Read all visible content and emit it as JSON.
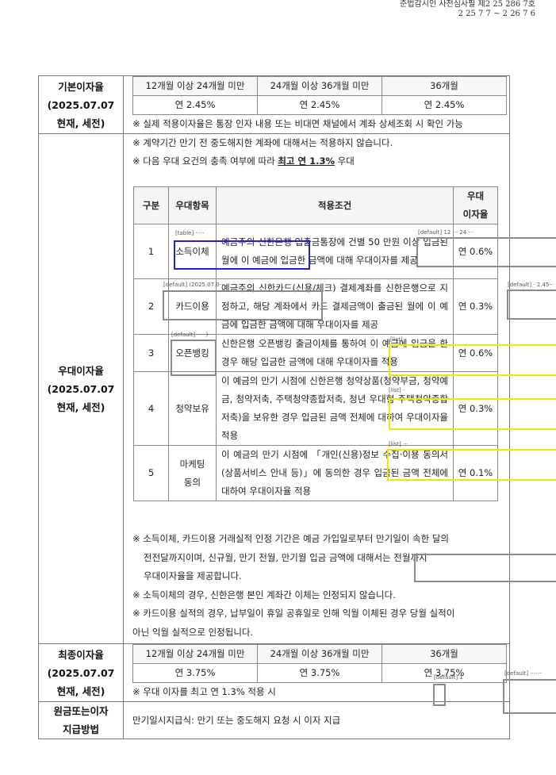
{
  "header": {
    "line1": "준법감시인 사전심사필 제2 25   286   7호",
    "line2": "2 25   7   7 ~ 2 26   7   6"
  },
  "base_rate": {
    "label": [
      "기본이자율",
      "(2025.07.07",
      "현재, 세전)"
    ],
    "headers": [
      "12개월 이상 24개월 미만",
      "24개월 이상 36개월 미만",
      "36개월"
    ],
    "values": [
      "연 2.45%",
      "연 2.45%",
      "연 2.45%"
    ],
    "note": "※ 실제 적용이자율은 통장 인자 내용 또는 비대면 채널에서 계좌 상세조회 시 확인 가능"
  },
  "preferential": {
    "label": [
      "우대이자율",
      "(2025.07.07",
      "현재, 세전)"
    ],
    "note1": "※ 계약기간 만기 전 중도해지한 계좌에 대해서는 적용하지 않습니다.",
    "note2_pre": "※ 다음 우대 요건의 충족 여부에 따라 ",
    "note2_u": "최고 연 1.3%",
    "note2_post": " 우대",
    "table_headers": [
      "구분",
      "우대항목",
      "적용조건",
      "우대",
      "이자율"
    ],
    "rows": [
      {
        "no": "1",
        "item": "소득이체",
        "cond": "예금주의 신한은행 입출금통장에 건별 50 만원 이상 입금된 월에 이 예금에 입금한 금액에 대해 우대이자를 제공",
        "rate": "연 0.6%"
      },
      {
        "no": "2",
        "item": "카드이용",
        "cond": "예금주의 신한카드(신용/체크) 결제계좌를 신한은행으로 지정하고, 해당 계좌에서 카드 결제금액이 출금된 월에 이 예금에 입금한 금액에 대해 우대이자를 제공",
        "rate": "연 0.3%"
      },
      {
        "no": "3",
        "item": "오픈뱅킹",
        "cond": "신한은행 오픈뱅킹 출금이체를 통하여 이 예금에 입금을 한 경우 해당 입금한 금액에 대해 우대이자를 적용",
        "rate": "연 0.6%"
      },
      {
        "no": "4",
        "item": "청약보유",
        "cond": "이 예금의 만기 시점에 신한은행 청약상품(청약부금, 청약예금, 청약저축, 주택청약종합저축, 청년 우대형 주택청약종합저축)을 보유한 경우 입금된 금액 전체에 대하여 우대이자율 적용",
        "rate": "연 0.3%"
      },
      {
        "no": "5",
        "item": "마케팅 동의",
        "cond": "이 예금의 만기 시점에 「개인(신용)정보 수집·이용 동의서(상품서비스 안내 등)」에 동의한 경우 입금된 금액 전체에 대하여 우대이자율 적용",
        "rate": "연 0.1%"
      }
    ],
    "foot1": "※ 소득이체, 카드이용 거래실적 인정 기간은 예금 가입일로부터 만기일이 속한 달의",
    "foot1b": "전전달까지이며, 신규월, 만기 전월, 만기월 입금 금액에 대해서는 전월까지",
    "foot1c": "우대이자율을 제공합니다.",
    "foot2": "※ 소득이체의 경우, 신한은행 본인 계좌간 이체는 인정되지 않습니다.",
    "foot3": "※ 카드이용 실적의 경우, 납부일이 휴일 공휴일로 인해 익월 이체된 경우 당월 실적이",
    "foot3b": "아닌 익월 실적으로 인정됩니다."
  },
  "final_rate": {
    "label": [
      "최종이자율",
      "(2025.07.07",
      "현재, 세전)"
    ],
    "headers": [
      "12개월 이상 24개월 미만",
      "24개월 이상 36개월 미만",
      "36개월"
    ],
    "values": [
      "연 3.75%",
      "연 3.75%",
      "연 3.75%"
    ],
    "note": "※ 우대 이자를 최고 연 1.3% 적용 시"
  },
  "payment": {
    "label": [
      "원금또는이자",
      "지급방법"
    ],
    "text": "만기일시지급식: 만기 또는 중도해지 요청 시 이자 지급"
  },
  "overlays": {
    "tag_table": "[table] ·····",
    "tag_default1": "[default] 12 ··· 24 ···",
    "tag_default2": "[default] (2025.07.0···",
    "tag_default3": "[default] · 2.45···",
    "tag_default4": "[default] ·· ··)",
    "tag_list": "[list] ·",
    "tag_list2": "[list] ·",
    "tag_list3": "[list] ···",
    "tag_default5": "[default] 1",
    "tag_default6": "[default] ·······",
    "colors": {
      "blue": "#2222cc",
      "yellow": "#f0e800",
      "gray": "#8a8a8a"
    }
  }
}
